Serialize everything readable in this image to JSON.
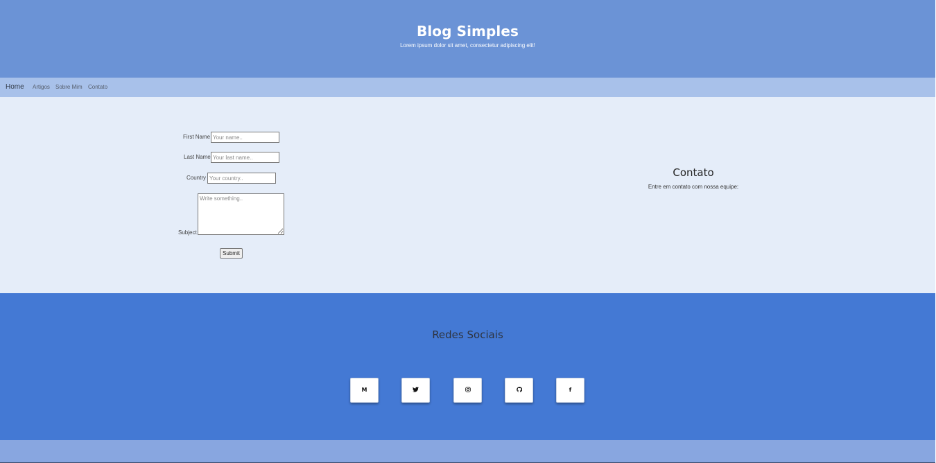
{
  "header": {
    "title": "Blog Simples",
    "subtitle": "Lorem ipsum dolor sit amet, consectetur adipiscing elit!"
  },
  "nav": {
    "items": [
      {
        "label": "Home"
      },
      {
        "label": "Artigos"
      },
      {
        "label": "Sobre Mim"
      },
      {
        "label": "Contato"
      }
    ]
  },
  "form": {
    "first_name": {
      "label": "First Name",
      "placeholder": "Your name..",
      "value": ""
    },
    "last_name": {
      "label": "Last Name",
      "placeholder": "Your last name..",
      "value": ""
    },
    "country": {
      "label": "Country",
      "placeholder": "Your country..",
      "value": ""
    },
    "subject": {
      "label": "Subject",
      "placeholder": "Write something..",
      "value": ""
    },
    "submit_label": "Submit"
  },
  "contact": {
    "title": "Contato",
    "text": "Entre em contato com nossa equipe:"
  },
  "social": {
    "title": "Redes Sociais",
    "buttons": [
      {
        "icon": "medium-icon",
        "glyph": "M"
      },
      {
        "icon": "twitter-icon",
        "glyph": "🐦"
      },
      {
        "icon": "instagram-icon",
        "glyph": "◎"
      },
      {
        "icon": "github-icon",
        "glyph": "◉"
      },
      {
        "icon": "facebook-icon",
        "glyph": "f"
      }
    ]
  },
  "colors": {
    "header_bg": "#6b93d6",
    "nav_bg": "#a8c1ea",
    "main_bg": "#e5edf9",
    "social_bg": "#4479d4",
    "footer_bg": "#88a6e0"
  }
}
